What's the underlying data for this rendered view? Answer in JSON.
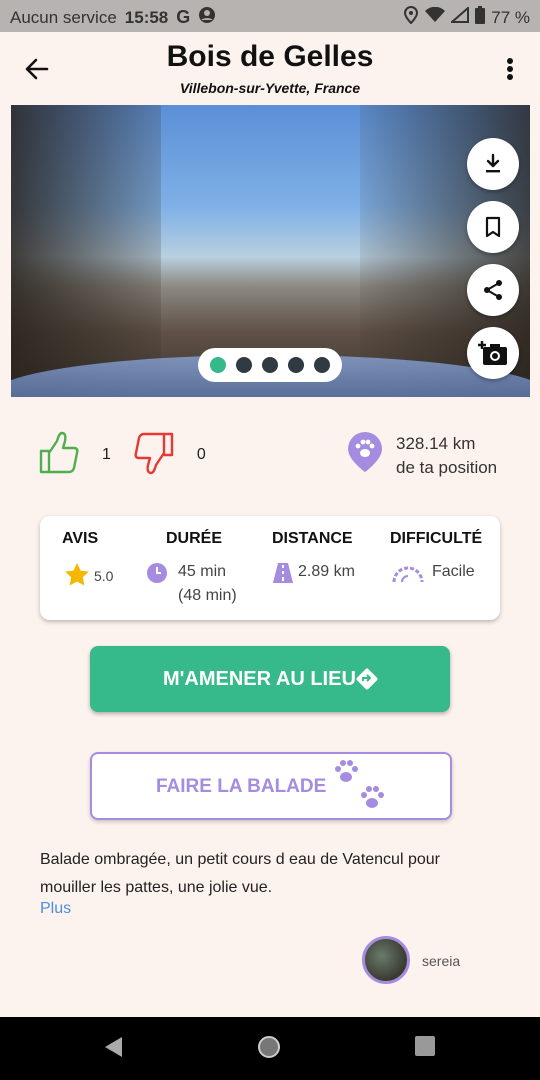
{
  "status_bar": {
    "carrier": "Aucun service",
    "time": "15:58",
    "battery": "77 %"
  },
  "header": {
    "title": "Bois de Gelles",
    "subtitle": "Villebon-sur-Yvette, France"
  },
  "gallery": {
    "photo_count": 5,
    "active_index": 0
  },
  "votes": {
    "likes": "1",
    "dislikes": "0"
  },
  "distance": {
    "value": "328.14 km",
    "suffix": "de ta position"
  },
  "stats": {
    "rating": {
      "label": "AVIS",
      "value": "5.0"
    },
    "duration": {
      "label": "DURÉE",
      "value": "45 min",
      "sub": "(48 min)"
    },
    "distance": {
      "label": "DISTANCE",
      "value": "2.89 km"
    },
    "difficulty": {
      "label": "DIFFICULTÉ",
      "value": "Facile"
    }
  },
  "actions": {
    "navigate_label": "M'AMENER AU LIEU",
    "walk_label": "FAIRE LA BALADE"
  },
  "description": {
    "text": "Balade ombragée, un petit cours d eau de Vatencul pour mouiller les pattes, une jolie vue.",
    "more_label": "Plus"
  },
  "author": {
    "name": "sereia"
  },
  "colors": {
    "accent_green": "#36b98b",
    "accent_purple": "#a68ce0",
    "link_blue": "#4a90e2",
    "background": "#fdf3ee"
  }
}
